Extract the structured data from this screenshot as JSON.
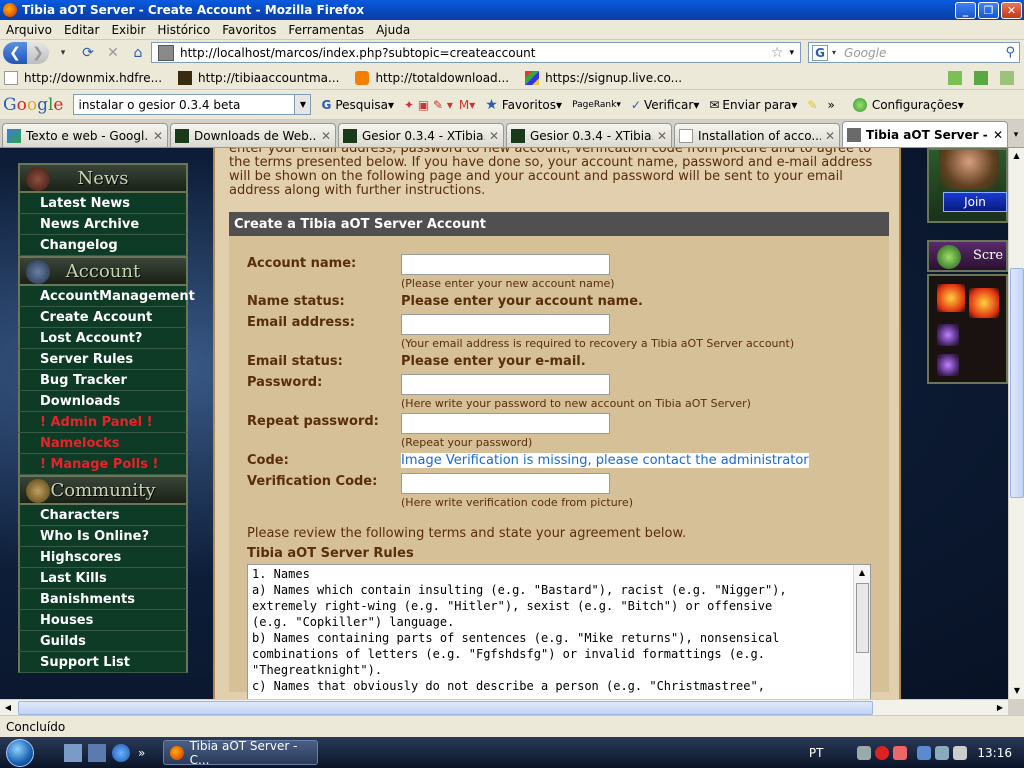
{
  "window": {
    "title": "Tibia aOT Server - Create Account - Mozilla Firefox"
  },
  "menu": [
    "Arquivo",
    "Editar",
    "Exibir",
    "Histórico",
    "Favoritos",
    "Ferramentas",
    "Ajuda"
  ],
  "nav": {
    "url": "http://localhost/marcos/index.php?subtopic=createaccount",
    "search_placeholder": "Google"
  },
  "bookmarks": [
    {
      "label": "http://downmix.hdfre...",
      "icon": "page-icon"
    },
    {
      "label": "http://tibiaaccountma...",
      "icon": "tibia-icon"
    },
    {
      "label": "http://totaldownload...",
      "icon": "blogger-icon"
    },
    {
      "label": "https://signup.live.co...",
      "icon": "windows-live-icon"
    }
  ],
  "google_toolbar": {
    "logo": "Google",
    "query": "instalar o gesior 0.3.4 beta",
    "items": [
      "Pesquisa",
      "Favoritos",
      "PageRank",
      "Verificar",
      "Enviar para",
      "»",
      "Configurações"
    ]
  },
  "tabs": [
    {
      "label": "Texto e web - Googl...",
      "active": false
    },
    {
      "label": "Downloads de Web...",
      "active": false
    },
    {
      "label": "Gesior 0.3.4 - XTibia...",
      "active": false
    },
    {
      "label": "Gesior 0.3.4 - XTibia...",
      "active": false
    },
    {
      "label": "Installation of acco...",
      "active": false
    },
    {
      "label": "Tibia aOT Server - ...",
      "active": true
    }
  ],
  "sidebar": {
    "sections": [
      {
        "title": "News",
        "items": [
          {
            "label": "Latest News",
            "red": false
          },
          {
            "label": "News Archive",
            "red": false
          },
          {
            "label": "Changelog",
            "red": false
          }
        ]
      },
      {
        "title": "Account",
        "items": [
          {
            "label": "AccountManagement",
            "red": false
          },
          {
            "label": "Create Account",
            "red": false
          },
          {
            "label": "Lost Account?",
            "red": false
          },
          {
            "label": "Server Rules",
            "red": false
          },
          {
            "label": "Bug Tracker",
            "red": false
          },
          {
            "label": "Downloads",
            "red": false
          },
          {
            "label": "! Admin Panel !",
            "red": true
          },
          {
            "label": "Namelocks",
            "red": true
          },
          {
            "label": "! Manage Polls !",
            "red": true
          }
        ]
      },
      {
        "title": "Community",
        "items": [
          {
            "label": "Characters",
            "red": false
          },
          {
            "label": "Who Is Online?",
            "red": false
          },
          {
            "label": "Highscores",
            "red": false
          },
          {
            "label": "Last Kills",
            "red": false
          },
          {
            "label": "Banishments",
            "red": false
          },
          {
            "label": "Houses",
            "red": false
          },
          {
            "label": "Guilds",
            "red": false
          },
          {
            "label": "Support List",
            "red": false
          }
        ]
      }
    ]
  },
  "form": {
    "intro": "enter your email address, password to new account, verification code from picture and to agree to the terms presented below. If you have done so, your account name, password and e-mail address will be shown on the following page and your account and password will be sent to your email address along with further instructions.",
    "heading": "Create a Tibia aOT Server Account",
    "account_name_label": "Account name:",
    "account_name_hint": "(Please enter your new account name)",
    "name_status_label": "Name status:",
    "name_status_value": "Please enter your account name.",
    "email_label": "Email address:",
    "email_hint": "(Your email address is required to recovery a Tibia aOT Server account)",
    "email_status_label": "Email status:",
    "email_status_value": "Please enter your e-mail.",
    "password_label": "Password:",
    "password_hint": "(Here write your password to new account on Tibia aOT Server)",
    "repeat_password_label": "Repeat password:",
    "repeat_password_hint": "(Repeat your password)",
    "code_label": "Code:",
    "code_value": "Image Verification is missing, please contact the administrator",
    "verification_label": "Verification Code:",
    "verification_hint": "(Here write verification code from picture)",
    "terms_intro": "Please review the following terms and state your agreement below.",
    "rules_title": "Tibia aOT Server Rules",
    "rules_text": "1. Names\na) Names which contain insulting (e.g. \"Bastard\"), racist (e.g. \"Nigger\"),\nextremely right-wing (e.g. \"Hitler\"), sexist (e.g. \"Bitch\") or offensive\n(e.g. \"Copkiller\") language.\nb) Names containing parts of sentences (e.g. \"Mike returns\"), nonsensical\ncombinations of letters (e.g. \"Fgfshdsfg\") or invalid formattings (e.g.\n\"Thegreatknight\").\nc) Names that obviously do not describe a person (e.g. \"Christmastree\","
  },
  "rightcol": {
    "join_label": "Join",
    "screenshots_label": "Scre"
  },
  "status": "Concluído",
  "taskbar": {
    "item": "Tibia aOT Server - C...",
    "lang": "PT",
    "clock": "13:16"
  }
}
